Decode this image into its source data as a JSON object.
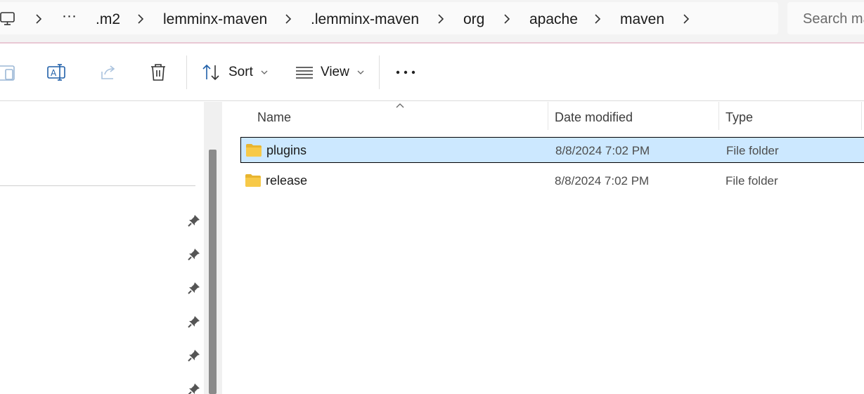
{
  "address_bar": {
    "more_label": "···",
    "crumbs": [
      ".m2",
      "lemminx-maven",
      ".lemminx-maven",
      "org",
      "apache",
      "maven"
    ]
  },
  "search": {
    "placeholder": "Search maven"
  },
  "toolbar": {
    "sort_label": "Sort",
    "view_label": "View",
    "more_label": "···"
  },
  "file_list": {
    "columns": {
      "name": "Name",
      "date": "Date modified",
      "type": "Type"
    },
    "rows": [
      {
        "name": "plugins",
        "date": "8/8/2024 7:02 PM",
        "type": "File folder",
        "selected": true
      },
      {
        "name": "release",
        "date": "8/8/2024 7:02 PM",
        "type": "File folder",
        "selected": false
      }
    ]
  },
  "colors": {
    "selection_bg": "#cce8ff",
    "folder_yellow": "#f7c948",
    "accent_blue": "#1f5fa8"
  }
}
